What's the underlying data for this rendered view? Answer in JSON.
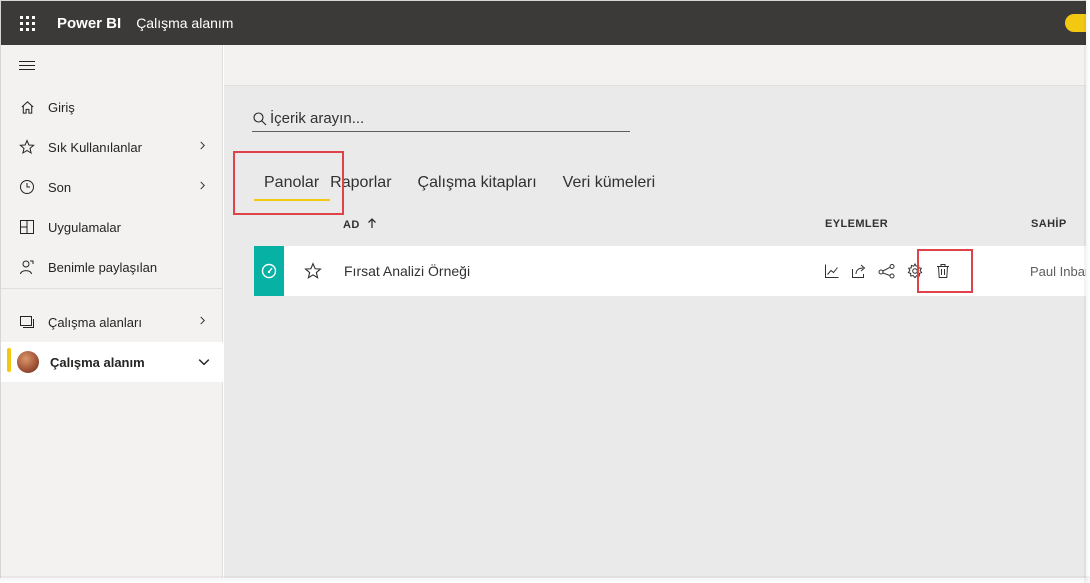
{
  "topbar": {
    "brand": "Power BI",
    "breadcrumb": "Çalışma alanım"
  },
  "nav": {
    "items": [
      {
        "label": "Giriş",
        "icon": "home-icon"
      },
      {
        "label": "Sık Kullanılanlar",
        "icon": "star-icon"
      },
      {
        "label": "Son",
        "icon": "clock-icon"
      },
      {
        "label": "Uygulamalar",
        "icon": "apps-icon"
      },
      {
        "label": "Benimle paylaşılan",
        "icon": "shared-person-icon"
      }
    ],
    "workspaces_label": "Çalışma alanları",
    "my_workspace_label": "Çalışma alanım"
  },
  "search": {
    "placeholder": "İçerik arayın..."
  },
  "tabs": [
    "Panolar",
    "Raporlar",
    "Çalışma kitapları",
    "Veri kümeleri"
  ],
  "table": {
    "columns": {
      "name": "AD",
      "actions": "EYLEMLER",
      "owner": "SAHİP"
    },
    "rows": [
      {
        "name": "Fırsat Analizi Örneği",
        "owner": "Paul Inbar"
      }
    ]
  },
  "colors": {
    "topbar": "#3b3a39",
    "accent": "#f2c811",
    "dashboard_tile": "#07b1a3",
    "highlight": "#e0424a"
  }
}
